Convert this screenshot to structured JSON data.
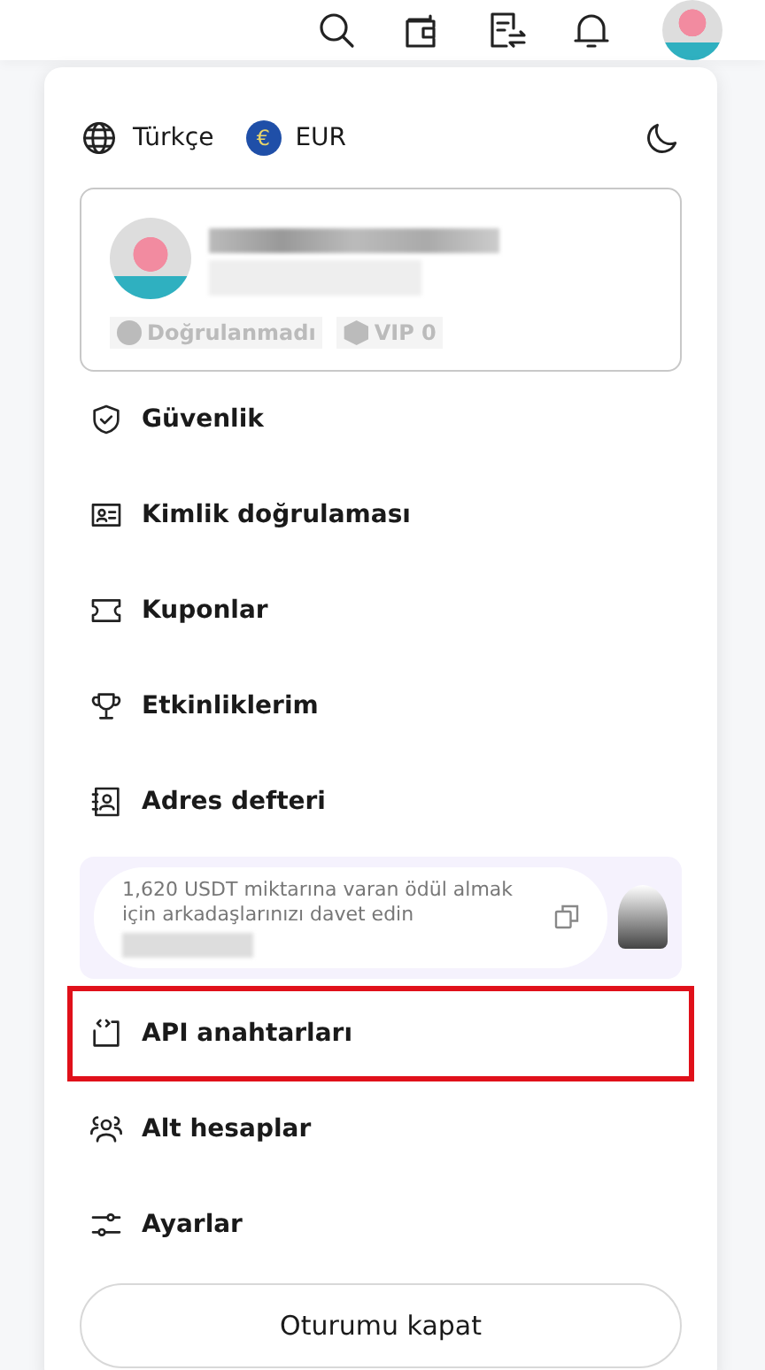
{
  "header": {
    "icons": [
      {
        "kind": "search"
      },
      {
        "kind": "wallet"
      },
      {
        "kind": "orders"
      },
      {
        "kind": "bell"
      }
    ]
  },
  "menu_panel": {
    "language": "Türkçe",
    "currency_symbol": "€",
    "currency": "EUR",
    "profile": {
      "badges": [
        {
          "kind": "verify",
          "label": "Doğrulanmadı"
        },
        {
          "kind": "vip",
          "label": "VIP 0"
        }
      ]
    },
    "items": [
      {
        "kind": "shield",
        "label": "Güvenlik",
        "highlighted": false
      },
      {
        "kind": "idcard",
        "label": "Kimlik doğrulaması",
        "highlighted": false
      },
      {
        "kind": "ticket",
        "label": "Kuponlar",
        "highlighted": false
      },
      {
        "kind": "trophy",
        "label": "Etkinliklerim",
        "highlighted": false
      },
      {
        "kind": "addressbook",
        "label": "Adres defteri",
        "highlighted": false
      },
      {
        "kind": "invite",
        "text": "1,620 USDT miktarına varan ödül almak için arkadaşlarınızı davet edin"
      },
      {
        "kind": "api",
        "label": "API anahtarları",
        "highlighted": true
      },
      {
        "kind": "users",
        "label": "Alt hesaplar",
        "highlighted": false
      },
      {
        "kind": "sliders",
        "label": "Ayarlar",
        "highlighted": false
      }
    ],
    "logout": "Oturumu kapat"
  }
}
